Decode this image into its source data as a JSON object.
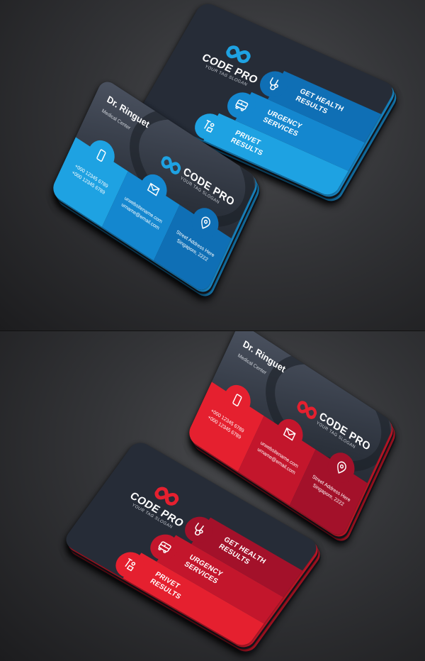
{
  "brand": {
    "name": "CODE PRO",
    "slogan": "YOUR TAG SLOGAN"
  },
  "services": [
    {
      "label_1": "GET HEALTH",
      "label_2": "RESULTS",
      "icon": "stethoscope-icon"
    },
    {
      "label_1": "URGENCY",
      "label_2": "SERVICES",
      "icon": "ambulance-icon"
    },
    {
      "label_1": "PRIVET",
      "label_2": "RESULTS",
      "icon": "patient-iv-icon"
    }
  ],
  "contact": {
    "name": "Dr. Ringuet",
    "title": "Medical Center",
    "phone_1": "+000 12345 6789",
    "phone_2": "+000 12345 6789",
    "website": "urwebsitename.com",
    "email": "urname@email.com",
    "address_1": "Street Address Here",
    "address_2": "Singapore, 2222"
  },
  "themes": {
    "blue": {
      "c1": "#0f6fb5",
      "c2": "#1487cf",
      "c3": "#1ea2e2",
      "stack": "#1a8fd0"
    },
    "red": {
      "c1": "#a3112a",
      "c2": "#c3162c",
      "c3": "#e5202f",
      "stack": "#c8182a"
    }
  }
}
